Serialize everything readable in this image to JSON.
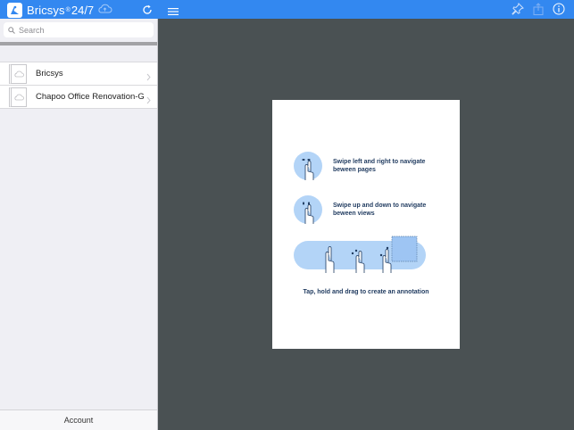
{
  "app": {
    "brand_name": "Bricsys",
    "brand_reg": "®",
    "brand_suffix": "24/7"
  },
  "search": {
    "placeholder": "Search"
  },
  "sidebar": {
    "items": [
      {
        "label": "Bricsys"
      },
      {
        "label": "Chapoo Office Renovation-G"
      }
    ],
    "account_label": "Account"
  },
  "document": {
    "gestures": [
      {
        "text": "Swipe left and right to navigate beween pages"
      },
      {
        "text": "Swipe up and down to navigate beween views"
      }
    ],
    "annotation_text": "Tap, hold and drag to create an annotation"
  },
  "colors": {
    "topbar": "#3388f0",
    "canvas": "#4a5153",
    "gesture_bubble": "#b3d4f7",
    "gesture_text": "#1f3a5f"
  },
  "icons": [
    "bricsys-logo-icon",
    "cloud-upload-icon",
    "refresh-icon",
    "hamburger-menu-icon",
    "pin-icon",
    "share-icon",
    "info-icon",
    "search-icon",
    "folder-cloud-icon",
    "chevron-right-icon"
  ]
}
